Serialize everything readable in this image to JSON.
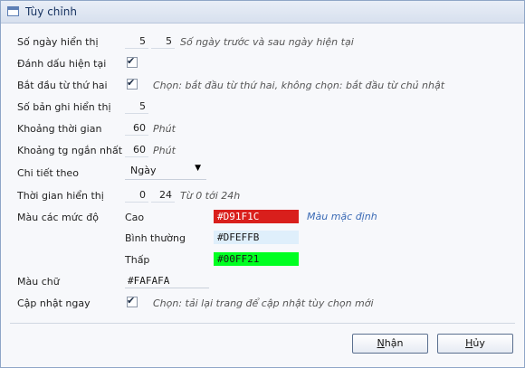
{
  "window": {
    "title": "Tùy chỉnh"
  },
  "rows": {
    "days_shown": {
      "label": "Số ngày hiển thị",
      "before": "5",
      "after": "5",
      "hint": "Số ngày trước và sau ngày hiện tại"
    },
    "mark_today": {
      "label": "Đánh dấu hiện tại",
      "checked": true
    },
    "start_monday": {
      "label": "Bắt đầu từ thứ hai",
      "checked": true,
      "hint": "Chọn: bắt đầu từ thứ hai, không chọn: bắt đầu từ chủ nhật"
    },
    "records_shown": {
      "label": "Số bản ghi hiển thị",
      "value": "5"
    },
    "time_range": {
      "label": "Khoảng thời gian",
      "value": "60",
      "unit": "Phút"
    },
    "min_range": {
      "label": "Khoảng tg ngắn nhất",
      "value": "60",
      "unit": "Phút"
    },
    "detail_by": {
      "label": "Chi tiết theo",
      "selected": "Ngày"
    },
    "display_time": {
      "label": "Thời gian hiển thị",
      "from": "0",
      "to": "24",
      "hint": "Từ 0 tới 24h"
    },
    "level_colors": {
      "label": "Màu các mức độ",
      "high": {
        "label": "Cao",
        "value": "#D91F1C",
        "color": "#D91F1C",
        "text_color": "#ffffff"
      },
      "normal": {
        "label": "Bình thường",
        "value": "#DFEFFB",
        "color": "#DFEFFB",
        "text_color": "#1a1a1a"
      },
      "low": {
        "label": "Thấp",
        "value": "#00FF21",
        "color": "#00FF21",
        "text_color": "#1a1a1a"
      },
      "default_link": "Màu mặc định"
    },
    "text_color": {
      "label": "Màu chữ",
      "value": "#FAFAFA"
    },
    "refresh_now": {
      "label": "Cập nhật ngay",
      "checked": true,
      "hint": "Chọn: tải lại trang để cập nhật tùy chọn mới"
    }
  },
  "buttons": {
    "ok": {
      "label": "Nhận",
      "accel": "N",
      "rest": "hận"
    },
    "cancel": {
      "label": "Hủy",
      "accel": "H",
      "rest": "ủy"
    }
  }
}
